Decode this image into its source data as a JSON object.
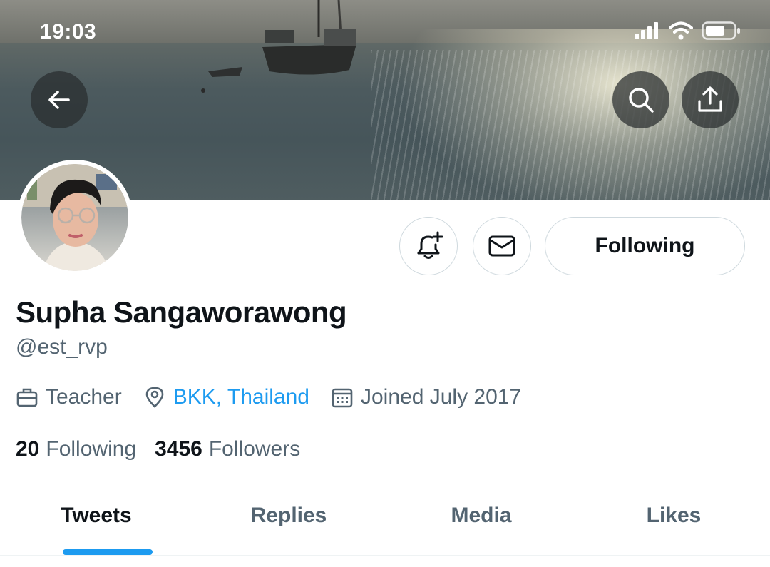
{
  "status_bar": {
    "time": "19:03"
  },
  "profile": {
    "name": "Supha Sangaworawong",
    "handle": "@est_rvp",
    "occupation": "Teacher",
    "location": "BKK, Thailand",
    "joined": "Joined July 2017",
    "following_count": "20",
    "following_label": "Following",
    "followers_count": "3456",
    "followers_label": "Followers"
  },
  "actions": {
    "follow_label": "Following"
  },
  "tabs": [
    {
      "label": "Tweets",
      "active": true
    },
    {
      "label": "Replies",
      "active": false
    },
    {
      "label": "Media",
      "active": false
    },
    {
      "label": "Likes",
      "active": false
    }
  ],
  "colors": {
    "accent": "#1d9bf0",
    "secondary_text": "#536471",
    "primary_text": "#0f1419"
  },
  "icons": [
    "back-arrow-icon",
    "search-icon",
    "share-icon",
    "notification-bell-plus-icon",
    "mail-icon",
    "briefcase-icon",
    "location-pin-icon",
    "calendar-icon",
    "signal-icon",
    "wifi-icon",
    "battery-icon"
  ]
}
